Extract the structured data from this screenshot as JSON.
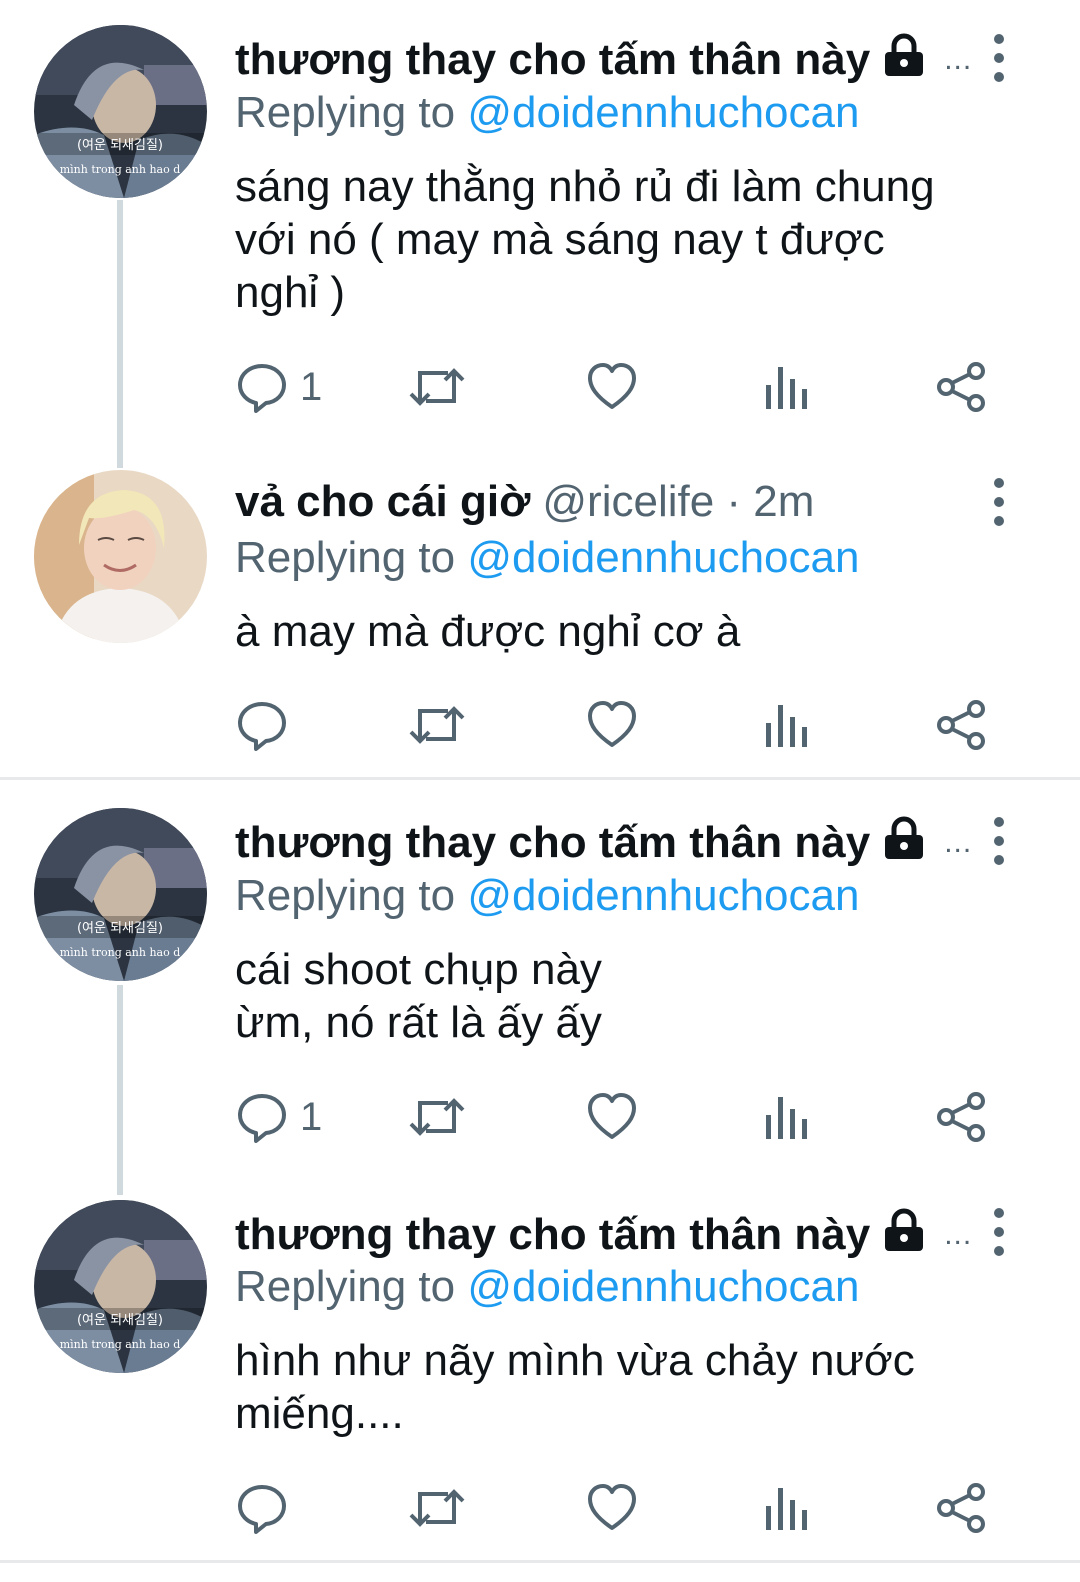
{
  "tweets": [
    {
      "author": "thương thay cho tấm thân này",
      "handle_time": "",
      "truncated": "...",
      "locked": true,
      "replying_prefix": "Replying to",
      "replying_to": "@doidennhuchocan",
      "text": "sáng nay thằng nhỏ rủ đi làm chung\nvới nó ( may mà sáng nay t được\nnghỉ )",
      "reply_count": "1",
      "avatar_caption": "(여운 되새김질)",
      "avatar_subcaption": "mình trong anh hao d"
    },
    {
      "author": "vả cho cái giờ",
      "handle_time": "@ricelife · 2m",
      "truncated": "",
      "locked": false,
      "replying_prefix": "Replying to",
      "replying_to": "@doidennhuchocan",
      "text": "à may mà được nghỉ cơ à",
      "reply_count": ""
    },
    {
      "author": "thương thay cho tấm thân này",
      "handle_time": "",
      "truncated": "...",
      "locked": true,
      "replying_prefix": "Replying to",
      "replying_to": "@doidennhuchocan",
      "text": "cái shoot chụp này\nừm, nó rất là ấy ấy",
      "reply_count": "1",
      "avatar_caption": "(여운 되새김질)",
      "avatar_subcaption": "mình trong anh hao d"
    },
    {
      "author": "thương thay cho tấm thân này",
      "handle_time": "",
      "truncated": "...",
      "locked": true,
      "replying_prefix": "Replying to",
      "replying_to": "@doidennhuchocan",
      "text": "hình như nãy mình vừa chảy nước\nmiếng....",
      "reply_count": "",
      "avatar_caption": "(여운 되새김질)",
      "avatar_subcaption": "mình trong anh hao d"
    }
  ],
  "colors": {
    "link": "#1d9bf0",
    "secondary": "#536471",
    "primary": "#0f1419",
    "thread_line": "#cfd9de",
    "divider": "#e7e9ea"
  },
  "icons": [
    "reply-icon",
    "retweet-icon",
    "like-icon",
    "analytics-icon",
    "share-icon",
    "lock-icon",
    "more-icon"
  ]
}
